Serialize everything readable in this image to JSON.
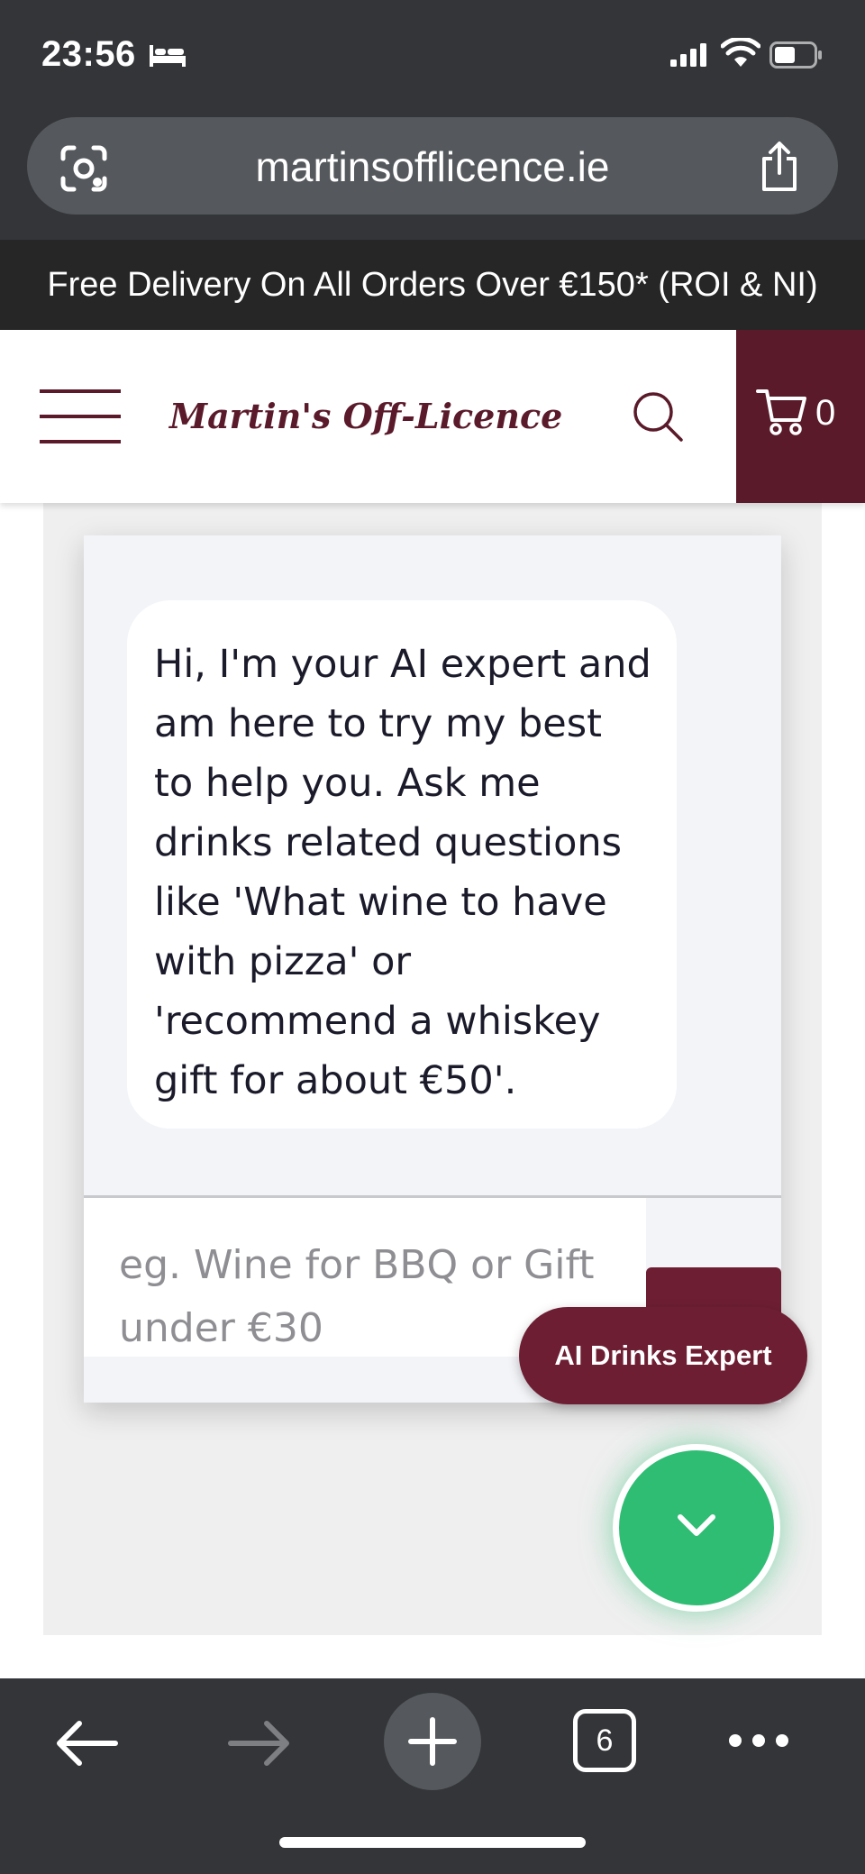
{
  "status_bar": {
    "time": "23:56"
  },
  "browser": {
    "url": "martinsofflicence.ie"
  },
  "site": {
    "banner": "Free Delivery On All Orders Over €150* (ROI & NI)",
    "logo_text": "Martin's Off-Licence",
    "cart_count": "0"
  },
  "chat": {
    "greeting": "Hi, I'm your AI expert and am here to try my best to help you. Ask me drinks related questions like 'What wine to have with pizza' or 'recommend a whiskey gift for about €50'.",
    "input_placeholder": "eg. Wine for BBQ or Gift under €30",
    "widget_label": "AI Drinks Expert"
  },
  "toolbar": {
    "tab_count": "6"
  },
  "colors": {
    "brand": "#5a1a2a",
    "accent_green": "#2fbd74",
    "browser_chrome": "#333538"
  }
}
